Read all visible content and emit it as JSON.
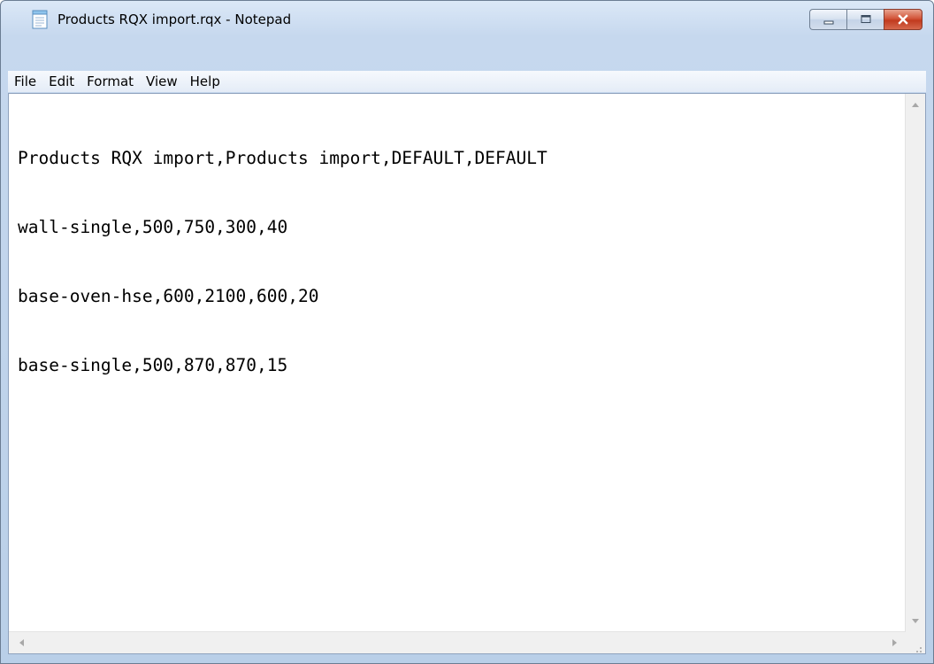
{
  "window": {
    "title": "Products RQX import.rqx - Notepad",
    "icon": "notepad-icon"
  },
  "caption_buttons": {
    "minimize_icon": "minimize-icon",
    "maximize_icon": "maximize-icon",
    "close_icon": "close-icon",
    "close_color": "#c7432a"
  },
  "menu": {
    "items": [
      {
        "label": "File"
      },
      {
        "label": "Edit"
      },
      {
        "label": "Format"
      },
      {
        "label": "View"
      },
      {
        "label": "Help"
      }
    ]
  },
  "editor": {
    "lines": [
      "Products RQX import,Products import,DEFAULT,DEFAULT",
      "wall-single,500,750,300,40",
      "base-oven-hse,600,2100,600,20",
      "base-single,500,870,870,15"
    ]
  },
  "colors": {
    "frame": "#c6d8ee",
    "menubar": "#e9eff8",
    "editor_bg": "#ffffff"
  }
}
